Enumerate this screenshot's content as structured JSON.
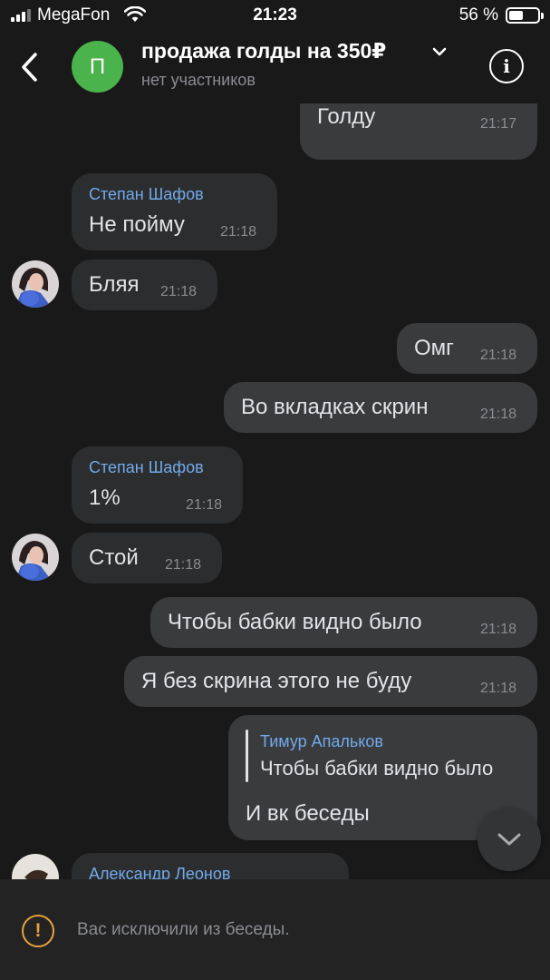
{
  "status_bar": {
    "carrier": "MegaFon",
    "time": "21:23",
    "battery": "56 %",
    "battery_level": 0.56
  },
  "header": {
    "avatar_letter": "П",
    "title": "продажа голды на 350₽",
    "subtitle": "нет участников"
  },
  "messages": [
    {
      "text": "Голду",
      "time": "21:17"
    },
    {
      "name": "Степан Шафов",
      "text": "Не пойму",
      "time": "21:18"
    },
    {
      "text": "Бляя",
      "time": "21:18"
    },
    {
      "text": "Омг",
      "time": "21:18"
    },
    {
      "text": "Во вкладках скрин",
      "time": "21:18"
    },
    {
      "name": "Степан Шафов",
      "text": "1%",
      "time": "21:18"
    },
    {
      "text": "Стой",
      "time": "21:18"
    },
    {
      "text": "Чтобы бабки видно было",
      "time": "21:18"
    },
    {
      "text": "Я без скрина этого не буду",
      "time": "21:18"
    },
    {
      "reply_name": "Тимур Апальков",
      "reply_text": "Чтобы бабки видно было",
      "text": "И вк беседы"
    },
    {
      "name": "Александр Леонов"
    }
  ],
  "footer": {
    "notice": "Вас исключили из беседы."
  },
  "colors": {
    "background": "#19191a",
    "bubble_in": "#2c2d2e",
    "bubble_out": "#3a3b3d",
    "name_link": "#71aaeb",
    "avatar_green": "#4bb34b",
    "warning": "#e9a23b"
  }
}
